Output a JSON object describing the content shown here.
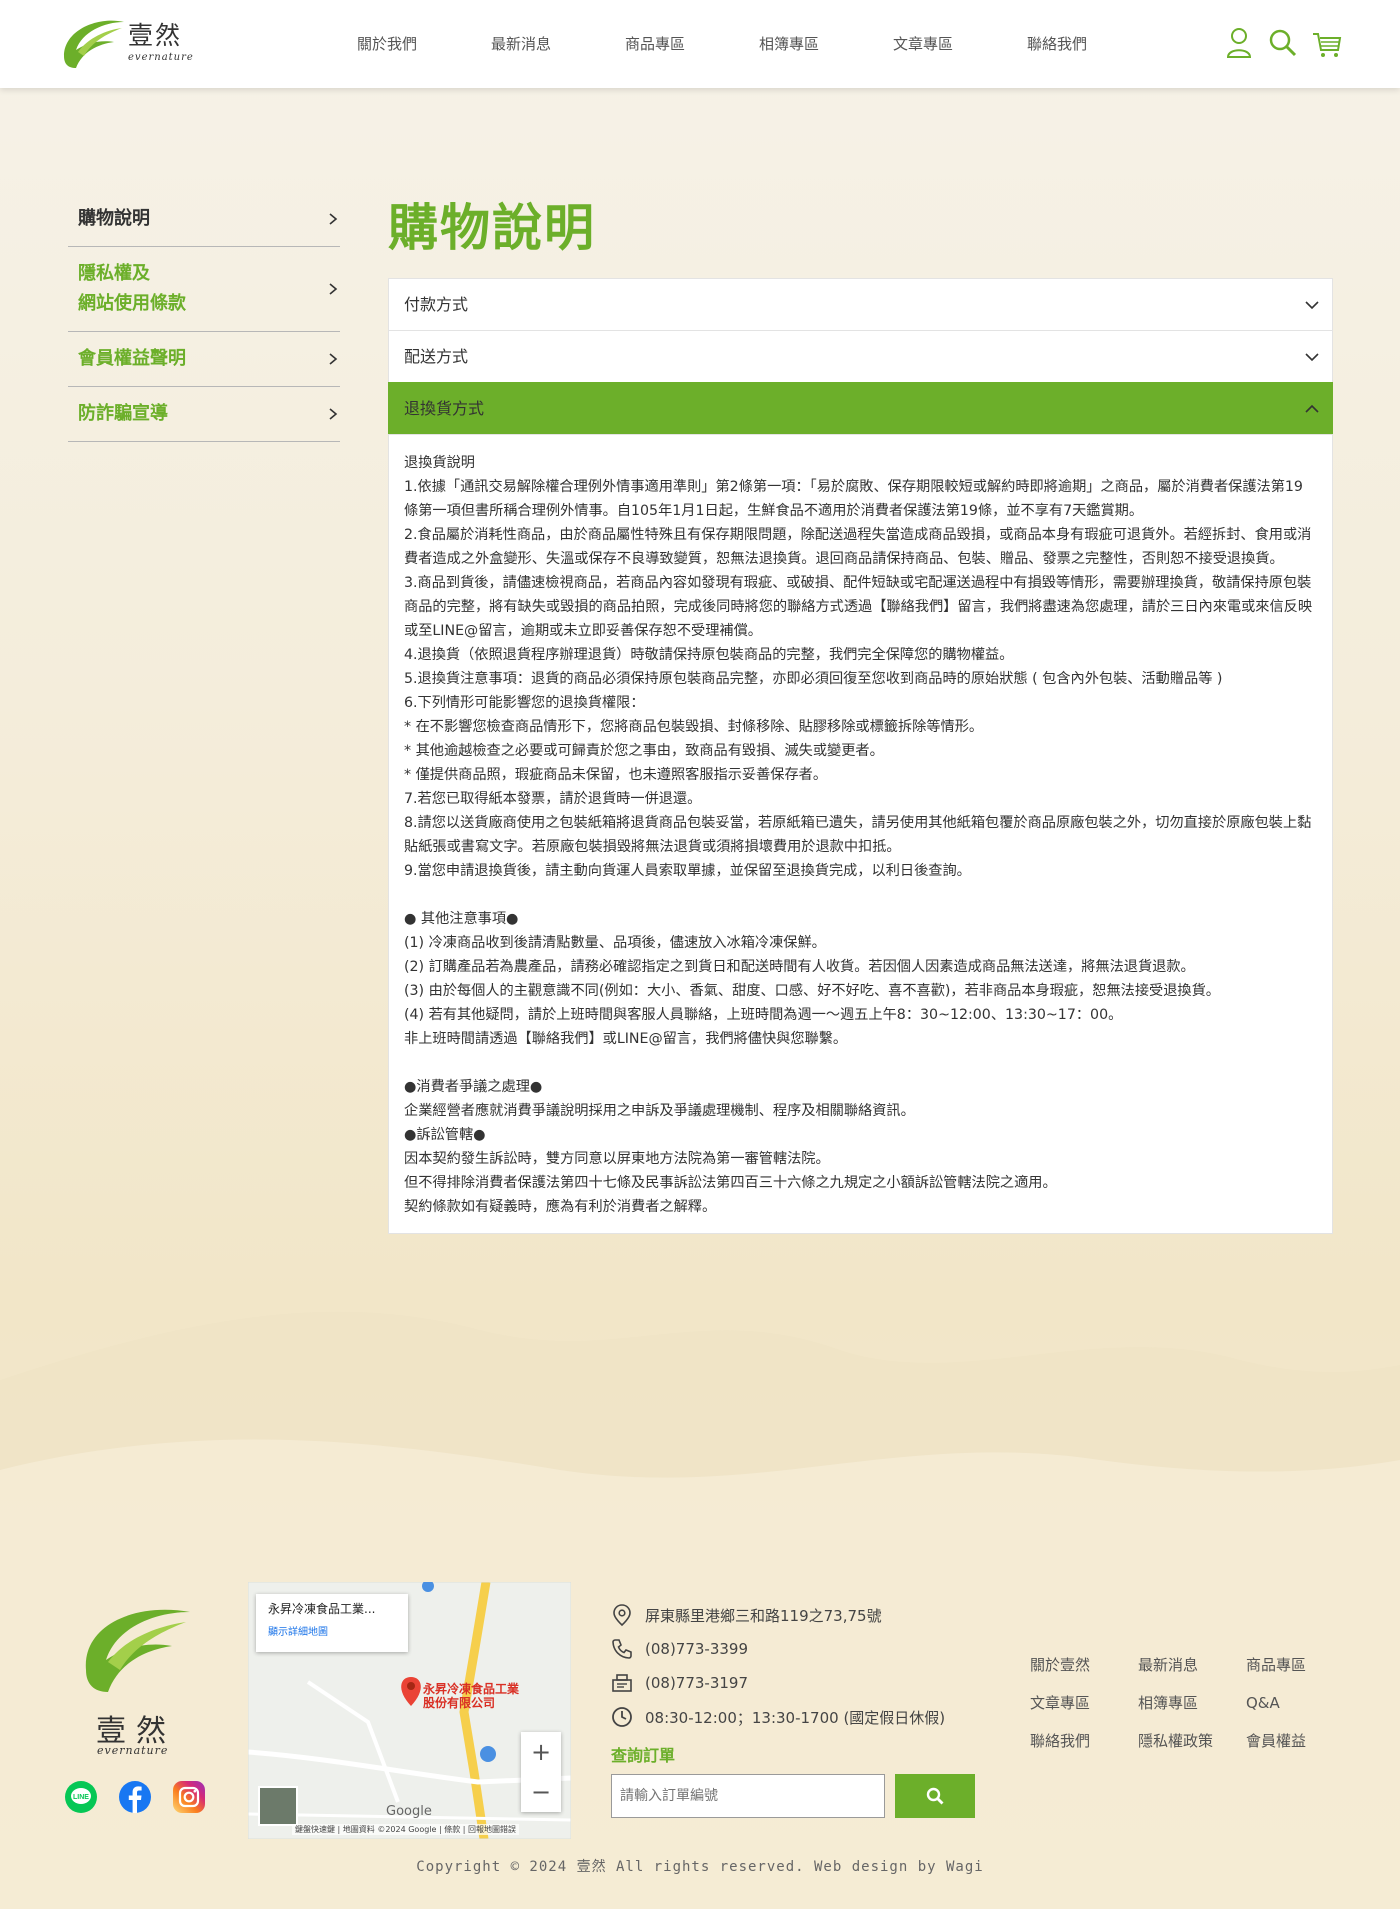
{
  "brand": {
    "name_zh": "壹然",
    "name_en": "evernature",
    "primary_color": "#6caf2a"
  },
  "nav": [
    "關於我們",
    "最新消息",
    "商品專區",
    "相簿專區",
    "文章專區",
    "聯絡我們"
  ],
  "header_icons": [
    "user-icon",
    "search-icon",
    "cart-icon"
  ],
  "sidebar": {
    "items": [
      {
        "label": "購物說明",
        "active": true
      },
      {
        "label": "隱私權及\n網站使用條款",
        "active": false
      },
      {
        "label": "會員權益聲明",
        "active": false
      },
      {
        "label": "防詐騙宣導",
        "active": false
      }
    ]
  },
  "page": {
    "title": "購物說明"
  },
  "accordion": {
    "sections": [
      {
        "title": "付款方式",
        "open": false
      },
      {
        "title": "配送方式",
        "open": false
      },
      {
        "title": "退換貨方式",
        "open": true
      }
    ],
    "body_lines": [
      "退換貨說明",
      "1.依據「通訊交易解除權合理例外情事適用準則」第2條第一項：「易於腐敗、保存期限較短或解約時即將逾期」之商品，屬於消費者保護法第19條第一項但書所稱合理例外情事。自105年1月1日起，生鮮食品不適用於消費者保護法第19條，並不享有7天鑑賞期。",
      "2.食品屬於消耗性商品，由於商品屬性特殊且有保存期限問題，除配送過程失當造成商品毀損，或商品本身有瑕疵可退貨外。若經拆封、食用或消費者造成之外盒變形、失溫或保存不良導致變質，恕無法退換貨。退回商品請保持商品、包裝、贈品、發票之完整性，否則恕不接受退換貨。",
      "3.商品到貨後，請儘速檢視商品，若商品內容如發現有瑕疵、或破損、配件短缺或宅配運送過程中有損毀等情形，需要辦理換貨，敬請保持原包裝商品的完整，將有缺失或毀損的商品拍照，完成後同時將您的聯絡方式透過【聯絡我們】留言，我們將盡速為您處理，請於三日內來電或來信反映或至LINE@留言，逾期或未立即妥善保存恕不受理補償。",
      "4.退換貨（依照退貨程序辦理退貨）時敬請保持原包裝商品的完整，我們完全保障您的購物權益。",
      "5.退換貨注意事項：退貨的商品必須保持原包裝商品完整，亦即必須回復至您收到商品時的原始狀態 ( 包含內外包裝、活動贈品等 )",
      "6.下列情形可能影響您的退換貨權限：",
      "* 在不影響您檢查商品情形下，您將商品包裝毀損、封條移除、貼膠移除或標籤拆除等情形。",
      "* 其他逾越檢查之必要或可歸責於您之事由，致商品有毀損、滅失或變更者。",
      "* 僅提供商品照，瑕疵商品未保留，也未遵照客服指示妥善保存者。",
      "7.若您已取得紙本發票，請於退貨時一併退還。",
      "8.請您以送貨廠商使用之包裝紙箱將退貨商品包裝妥當，若原紙箱已遺失，請另使用其他紙箱包覆於商品原廠包裝之外，切勿直接於原廠包裝上黏貼紙張或書寫文字。若原廠包裝損毀將無法退貨或須將損壞費用於退款中扣抵。",
      "9.當您申請退換貨後，請主動向貨運人員索取單據，並保留至退換貨完成，以利日後查詢。",
      "",
      "● 其他注意事項●",
      "(1) 冷凍商品收到後請清點數量、品項後，儘速放入冰箱冷凍保鮮。",
      "(2) 訂購產品若為農產品，請務必確認指定之到貨日和配送時間有人收貨。若因個人因素造成商品無法送達，將無法退貨退款。",
      "(3) 由於每個人的主觀意識不同(例如：大小、香氣、甜度、口感、好不好吃、喜不喜歡)，若非商品本身瑕疵，恕無法接受退換貨。",
      "(4) 若有其他疑問，請於上班時間與客服人員聯絡，上班時間為週一～週五上午8：30~12:00、13:30~17：00。",
      "非上班時間請透過【聯絡我們】或LINE@留言，我們將儘快與您聯繫。",
      "",
      "●消費者爭議之處理●",
      "企業經營者應就消費爭議說明採用之申訴及爭議處理機制、程序及相關聯絡資訊。",
      "●訴訟管轄●",
      "因本契約發生訴訟時，雙方同意以屏東地方法院為第一審管轄法院。",
      "但不得排除消費者保護法第四十七條及民事訴訟法第四百三十六條之九規定之小額訴訟管轄法院之適用。",
      "契約條款如有疑義時，應為有利於消費者之解釋。"
    ]
  },
  "footer": {
    "map": {
      "card_title": "永昇冷凍食品工業...",
      "card_link": "顯示詳細地圖",
      "pin_label_1": "永昇冷凍食品工業",
      "pin_label_2": "股份有限公司",
      "google": "Google",
      "attribution": "鍵盤快速鍵 | 地圖資料 ©2024 Google | 條款 | 回報地圖錯誤"
    },
    "address": "屏東縣里港鄉三和路119之73,75號",
    "phone": "(08)773-3399",
    "fax": "(08)773-3197",
    "hours": "08:30-12:00；13:30-1700 (國定假日休假)",
    "query_title": "查詢訂單",
    "query_placeholder": "請輸入訂單編號",
    "links": [
      "關於壹然",
      "最新消息",
      "商品專區",
      "文章專區",
      "相簿專區",
      "Q&A",
      "聯絡我們",
      "隱私權政策",
      "會員權益"
    ],
    "social": [
      "line-icon",
      "facebook-icon",
      "instagram-icon"
    ],
    "copyright": "Copyright © 2024 壹然 All rights reserved. Web design by Wagi"
  }
}
